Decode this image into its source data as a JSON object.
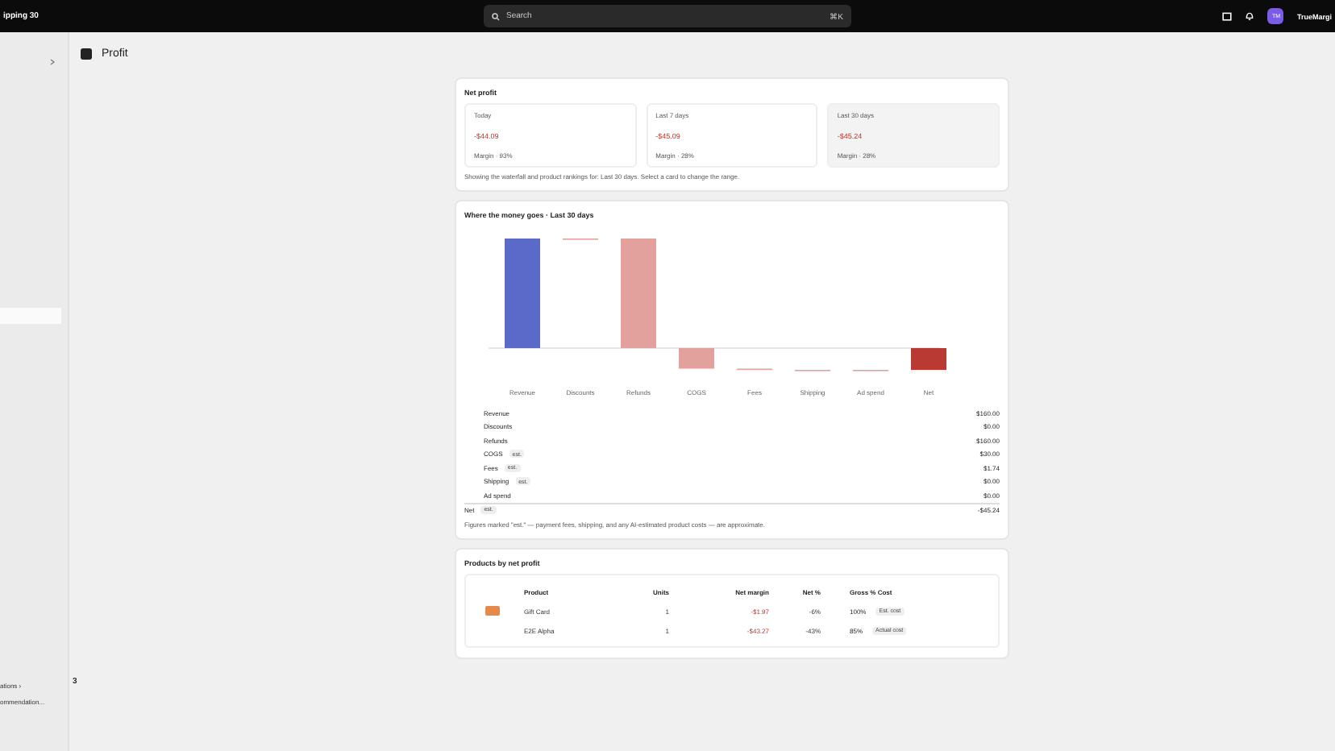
{
  "topbar": {
    "store": "ipping 30",
    "search": {
      "placeholder": "Search",
      "shortcut": "⌘K"
    },
    "avatar": "TM",
    "account": "TrueMargi"
  },
  "sidebar": {
    "items": [
      {
        "selected": true
      }
    ],
    "footer": [
      "ations ›",
      "ommendation..."
    ],
    "badge": "3"
  },
  "page": {
    "title": "Profit"
  },
  "net_profit": {
    "title": "Net profit",
    "cards": [
      {
        "label": "Today",
        "value": "-$44.09",
        "margin": "Margin · 93%",
        "selected": false
      },
      {
        "label": "Last 7 days",
        "value": "-$45.09",
        "margin": "Margin · 28%",
        "selected": false
      },
      {
        "label": "Last 30 days",
        "value": "-$45.24",
        "margin": "Margin · 28%",
        "selected": true
      }
    ],
    "note": "Showing the waterfall and product rankings for: Last 30 days. Select a card to change the range."
  },
  "waterfall": {
    "title": "Where the money goes · Last 30 days",
    "axis_labels": [
      "Revenue",
      "Discounts",
      "Refunds",
      "COGS",
      "Fees",
      "Shipping",
      "Ad spend",
      "Net"
    ],
    "rows": [
      {
        "kind": "item",
        "label": "Revenue",
        "value": "$160.00"
      },
      {
        "kind": "item",
        "label": "Discounts",
        "value": "$0.00"
      },
      {
        "kind": "item",
        "label": "Refunds",
        "value": "$160.00"
      },
      {
        "kind": "item",
        "label": "COGS",
        "tag": "est.",
        "value": "$30.00"
      },
      {
        "kind": "item",
        "label": "Fees",
        "tag": "est.",
        "value": "$1.74"
      },
      {
        "kind": "item",
        "label": "Shipping",
        "tag": "est.",
        "value": "$0.00"
      },
      {
        "kind": "item",
        "label": "Ad spend",
        "value": "$0.00"
      },
      {
        "kind": "total",
        "label": "Net",
        "tag": "est.",
        "value": "-$45.24"
      }
    ],
    "footnote": "Figures marked \"est.\" — payment fees, shipping, and any AI-estimated product costs — are approximate."
  },
  "products": {
    "title": "Products by net profit",
    "columns": [
      "Product",
      "Units",
      "Net margin",
      "Net %",
      "Gross % Cost"
    ],
    "rows": [
      {
        "thumbnail": true,
        "name": "Gift Card",
        "units": "1",
        "net_margin": "-$1.97",
        "net_pct": "-6%",
        "gross": "100%",
        "cost_tag": "Est. cost"
      },
      {
        "thumbnail": false,
        "name": "E2E Alpha",
        "units": "1",
        "net_margin": "-$43.27",
        "net_pct": "-43%",
        "gross": "85%",
        "cost_tag": "Actual cost"
      }
    ]
  }
}
